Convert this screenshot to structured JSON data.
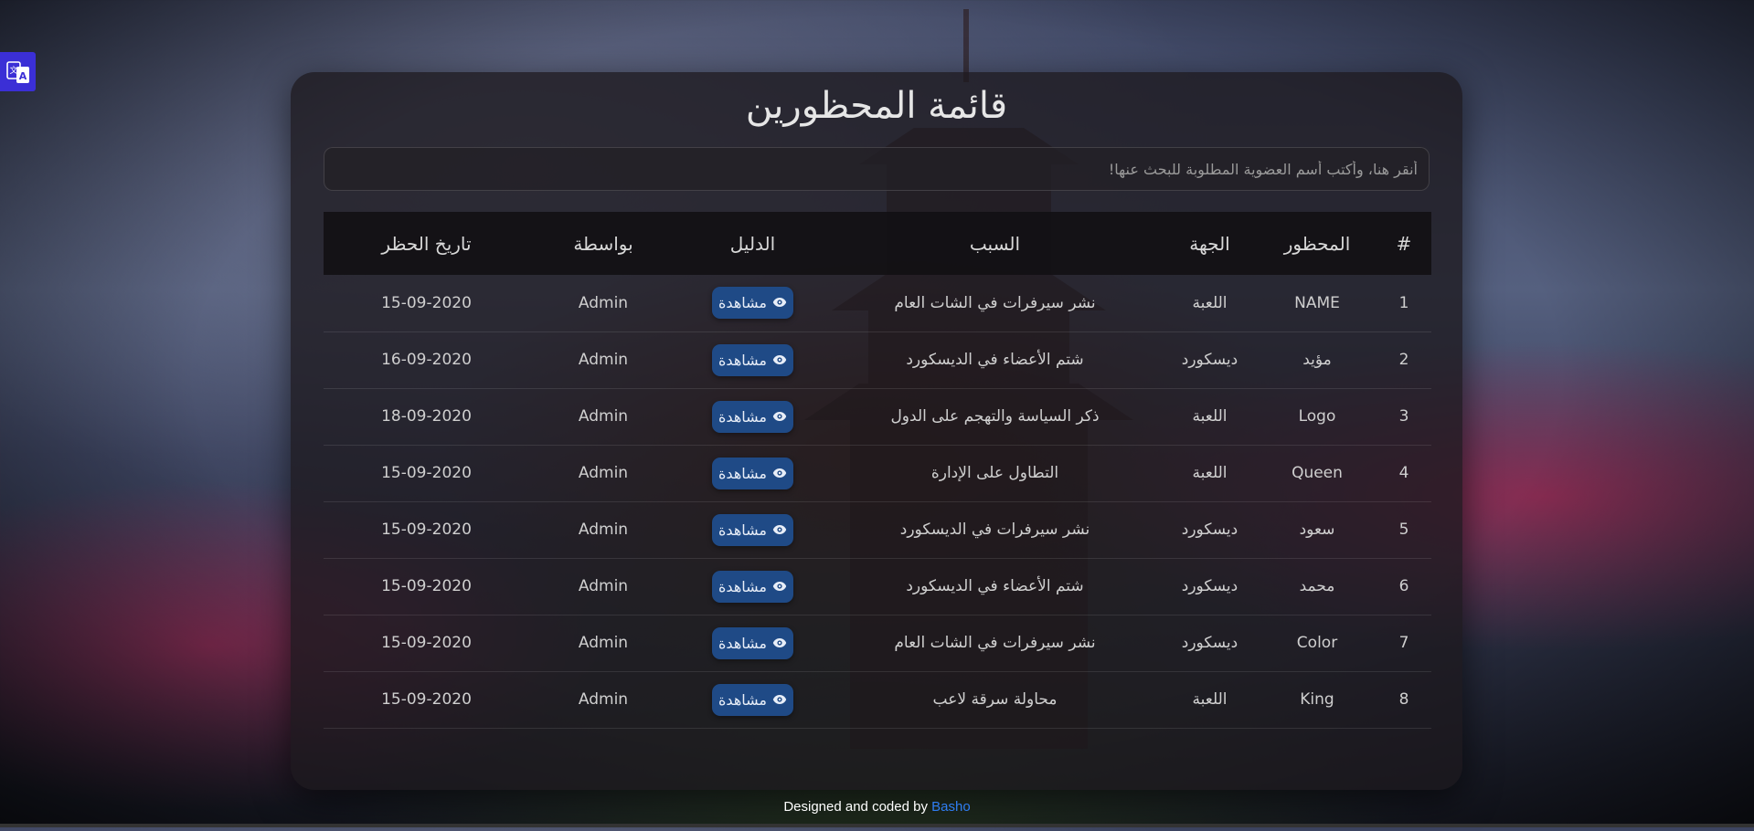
{
  "page": {
    "title": "قائمة المحظورين"
  },
  "search": {
    "placeholder": "أنقر هنا، وأكتب أسم العضوية المطلوبة للبحث عنها!"
  },
  "table": {
    "headers": [
      "#",
      "المحظور",
      "الجهة",
      "السبب",
      "الدليل",
      "بواسطة",
      "تاريخ الحظر"
    ],
    "rows": [
      {
        "num": "1",
        "name": "NAME",
        "side": "اللعبة",
        "reason": "نشر سيرفرات في الشات العام",
        "proof": "مشاهدة",
        "by": "Admin",
        "date": "15-09-2020"
      },
      {
        "num": "2",
        "name": "مؤيد",
        "side": "ديسكورد",
        "reason": "شتم الأعضاء في الديسكورد",
        "proof": "مشاهدة",
        "by": "Admin",
        "date": "16-09-2020"
      },
      {
        "num": "3",
        "name": "Logo",
        "side": "اللعبة",
        "reason": "ذكر السياسة والتهجم على الدول",
        "proof": "مشاهدة",
        "by": "Admin",
        "date": "18-09-2020"
      },
      {
        "num": "4",
        "name": "Queen",
        "side": "اللعبة",
        "reason": "التطاول على الإدارة",
        "proof": "مشاهدة",
        "by": "Admin",
        "date": "15-09-2020"
      },
      {
        "num": "5",
        "name": "سعود",
        "side": "ديسكورد",
        "reason": "نشر سيرفرات في الديسكورد",
        "proof": "مشاهدة",
        "by": "Admin",
        "date": "15-09-2020"
      },
      {
        "num": "6",
        "name": "محمد",
        "side": "ديسكورد",
        "reason": "شتم الأعضاء في الديسكورد",
        "proof": "مشاهدة",
        "by": "Admin",
        "date": "15-09-2020"
      },
      {
        "num": "7",
        "name": "Color",
        "side": "ديسكورد",
        "reason": "نشر سيرفرات في الشات العام",
        "proof": "مشاهدة",
        "by": "Admin",
        "date": "15-09-2020"
      },
      {
        "num": "8",
        "name": "King",
        "side": "اللعبة",
        "reason": "محاولة سرقة لاعب",
        "proof": "مشاهدة",
        "by": "Admin",
        "date": "15-09-2020"
      }
    ]
  },
  "footer": {
    "prefix": "Designed and coded by ",
    "author": "Basho"
  },
  "icons": {
    "proof_button": "eye-icon",
    "translate_widget": "translate-icon"
  },
  "colors": {
    "button": "#1f4a86",
    "footer_link": "#2f7df2",
    "translate_widget": "#3b2fd6"
  }
}
